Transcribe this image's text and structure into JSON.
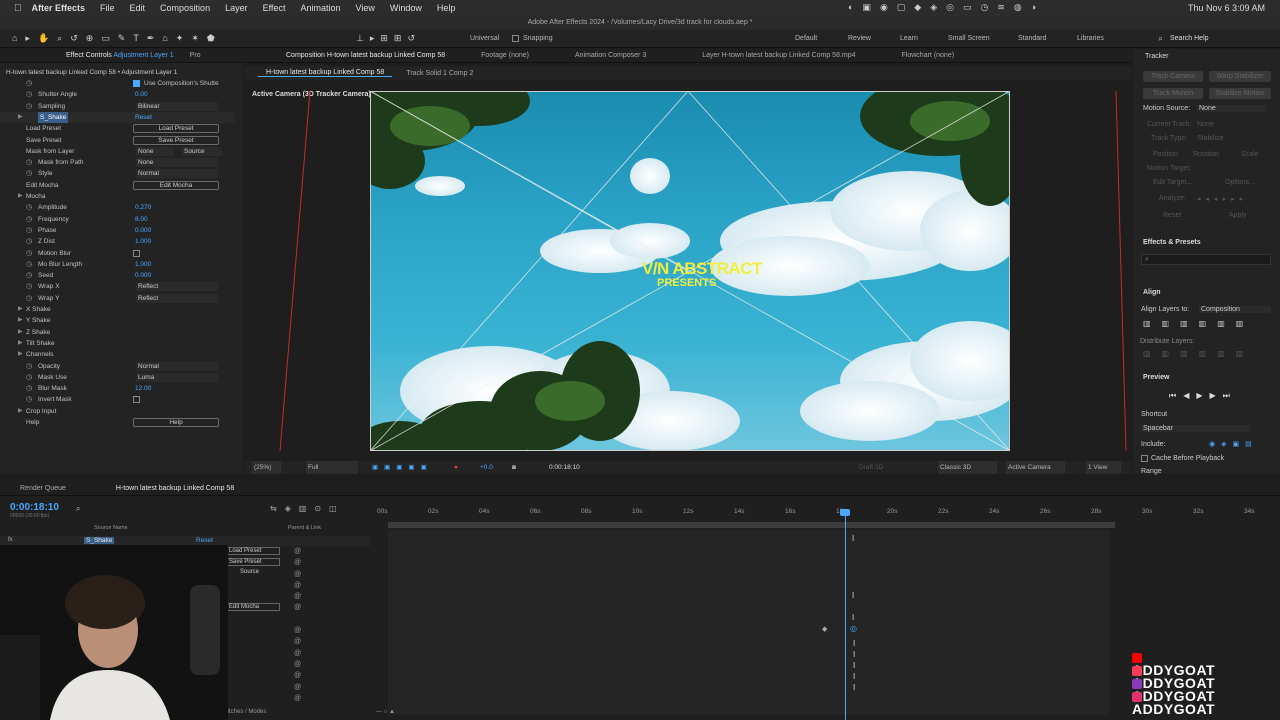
{
  "menubar": {
    "app": "After Effects",
    "items": [
      "File",
      "Edit",
      "Composition",
      "Layer",
      "Effect",
      "Animation",
      "View",
      "Window",
      "Help"
    ],
    "clock": "Thu Nov 6  3:09 AM"
  },
  "window_title": "Adobe After Effects 2024 - /Volumes/Lacy Drive/3d track for clouds.aep *",
  "toolbar": {
    "universal": "Universal",
    "snapping": "Snapping",
    "workspaces": [
      "Default",
      "Review",
      "Learn",
      "Small Screen",
      "Standard",
      "Libraries"
    ],
    "search_placeholder": "Search Help"
  },
  "effect_controls": {
    "tab": "Effect Controls",
    "tab_layer": "Adjustment Layer 1",
    "pro": "Pro",
    "header": "H-town latest backup Linked Comp 58 • Adjustment Layer 1",
    "rows": [
      {
        "label": "Use Composition's Shutte",
        "kind": "check",
        "checked": true
      },
      {
        "label": "Shutter Angle",
        "kind": "val",
        "value": "0.00"
      },
      {
        "label": "Sampling",
        "kind": "dd",
        "value": "Bilinear"
      },
      {
        "label": "S_Shake",
        "kind": "fx",
        "value": "Reset"
      },
      {
        "label": "Load Preset",
        "kind": "btn",
        "value": "Load Preset"
      },
      {
        "label": "Save Preset",
        "kind": "btn",
        "value": "Save Preset"
      },
      {
        "label": "Mask from Layer",
        "kind": "dd2",
        "value": "None",
        "value2": "Source"
      },
      {
        "label": "Mask from Path",
        "kind": "dd",
        "value": "None"
      },
      {
        "label": "Style",
        "kind": "dd",
        "value": "Normal"
      },
      {
        "label": "Edit Mocha",
        "kind": "btn",
        "value": "Edit Mocha"
      },
      {
        "label": "Mocha",
        "kind": "group"
      },
      {
        "label": "Amplitude",
        "kind": "val",
        "value": "0.270"
      },
      {
        "label": "Frequency",
        "kind": "val",
        "value": "8.00"
      },
      {
        "label": "Phase",
        "kind": "val",
        "value": "0.000"
      },
      {
        "label": "Z Dist",
        "kind": "val",
        "value": "1.000"
      },
      {
        "label": "Motion Blur",
        "kind": "check",
        "checked": false
      },
      {
        "label": "Mo Blur Length",
        "kind": "val",
        "value": "1.000"
      },
      {
        "label": "Seed",
        "kind": "val",
        "value": "0.000"
      },
      {
        "label": "Wrap X",
        "kind": "dd",
        "value": "Reflect"
      },
      {
        "label": "Wrap Y",
        "kind": "dd",
        "value": "Reflect"
      },
      {
        "label": "X Shake",
        "kind": "group"
      },
      {
        "label": "Y Shake",
        "kind": "group"
      },
      {
        "label": "Z Shake",
        "kind": "group"
      },
      {
        "label": "Tilt Shake",
        "kind": "group"
      },
      {
        "label": "Channels",
        "kind": "group"
      },
      {
        "label": "Opacity",
        "kind": "dd",
        "value": "Normal"
      },
      {
        "label": "Mask Use",
        "kind": "dd",
        "value": "Luma"
      },
      {
        "label": "Blur Mask",
        "kind": "val",
        "value": "12.00"
      },
      {
        "label": "Invert Mask",
        "kind": "check",
        "checked": false
      },
      {
        "label": "Crop Input",
        "kind": "group"
      },
      {
        "label": "Help",
        "kind": "btn",
        "value": "Help"
      }
    ]
  },
  "composition": {
    "tabs": [
      "Composition H-town latest backup Linked Comp 58",
      "Footage (none)",
      "Animation Composer 3",
      "Layer H-town latest backup Linked Comp 58.mp4",
      "Flowchart (none)"
    ],
    "subtabs": [
      "H-town latest backup Linked Comp 58",
      "Track Solid 1 Comp 2"
    ],
    "camera_label": "Active Camera (3D Tracker Camera)",
    "title_line1": "V/N ABSTRACT",
    "title_line2": "PRESENTS",
    "footer": {
      "zoom": "(25%)",
      "res": "Full",
      "exposure": "+0.0",
      "timecode": "0:00:18:10",
      "renderer": "Classic 3D",
      "camera": "Active Camera",
      "views": "1 View",
      "draft": "Draft 3D"
    }
  },
  "tracker": {
    "title": "Tracker",
    "buttons": [
      "Track Camera",
      "Warp Stabilizer",
      "Track Motion",
      "Stabilize Motion"
    ],
    "motion_source_label": "Motion Source:",
    "motion_source": "None",
    "current_track": "Current Track:",
    "current_track_val": "None",
    "track_type": "Track Type:",
    "track_type_val": "Stabilize",
    "checks": [
      "Position",
      "Rotation",
      "Scale"
    ],
    "motion_target": "Motion Target:",
    "edit_target": "Edit Target...",
    "options": "Options...",
    "analyze": "Analyze:",
    "reset": "Reset",
    "apply": "Apply"
  },
  "effects_presets": {
    "title": "Effects & Presets",
    "search": "⌕"
  },
  "align": {
    "title": "Align",
    "label": "Align Layers to:",
    "target": "Composition",
    "distribute": "Distribute Layers:"
  },
  "preview": {
    "title": "Preview",
    "shortcut_label": "Shortcut",
    "shortcut": "Spacebar",
    "include": "Include:",
    "cache": "Cache Before Playback",
    "range": "Range"
  },
  "timeline": {
    "render_queue": "Render Queue",
    "comp_tab": "H-town latest backup Linked Comp 58",
    "timecode": "0:00:18:10",
    "fps": "00550 (30.00 fps)",
    "col_source": "Source Name",
    "col_parent": "Parent & Link",
    "layer": "S_Shake",
    "layer_reset": "Reset",
    "ticks": [
      "00s",
      "02s",
      "04s",
      "06s",
      "08s",
      "10s",
      "12s",
      "14s",
      "16s",
      "18s",
      "20s",
      "22s",
      "24s",
      "26s",
      "28s",
      "30s",
      "32s",
      "34s"
    ],
    "switches": "Toggle Switches / Modes",
    "sub_rows": [
      "Load Preset",
      "Save Preset",
      "Source",
      "Edit Mocha"
    ]
  },
  "watermark": {
    "lines": [
      "ADDYGOAT",
      "ADDYGOAT",
      "ADDYGOAT",
      "ADDYGOAT"
    ],
    "colors": [
      "#ff0000",
      "#ff3b5c",
      "#8a3ab9",
      "#e1306c"
    ]
  }
}
